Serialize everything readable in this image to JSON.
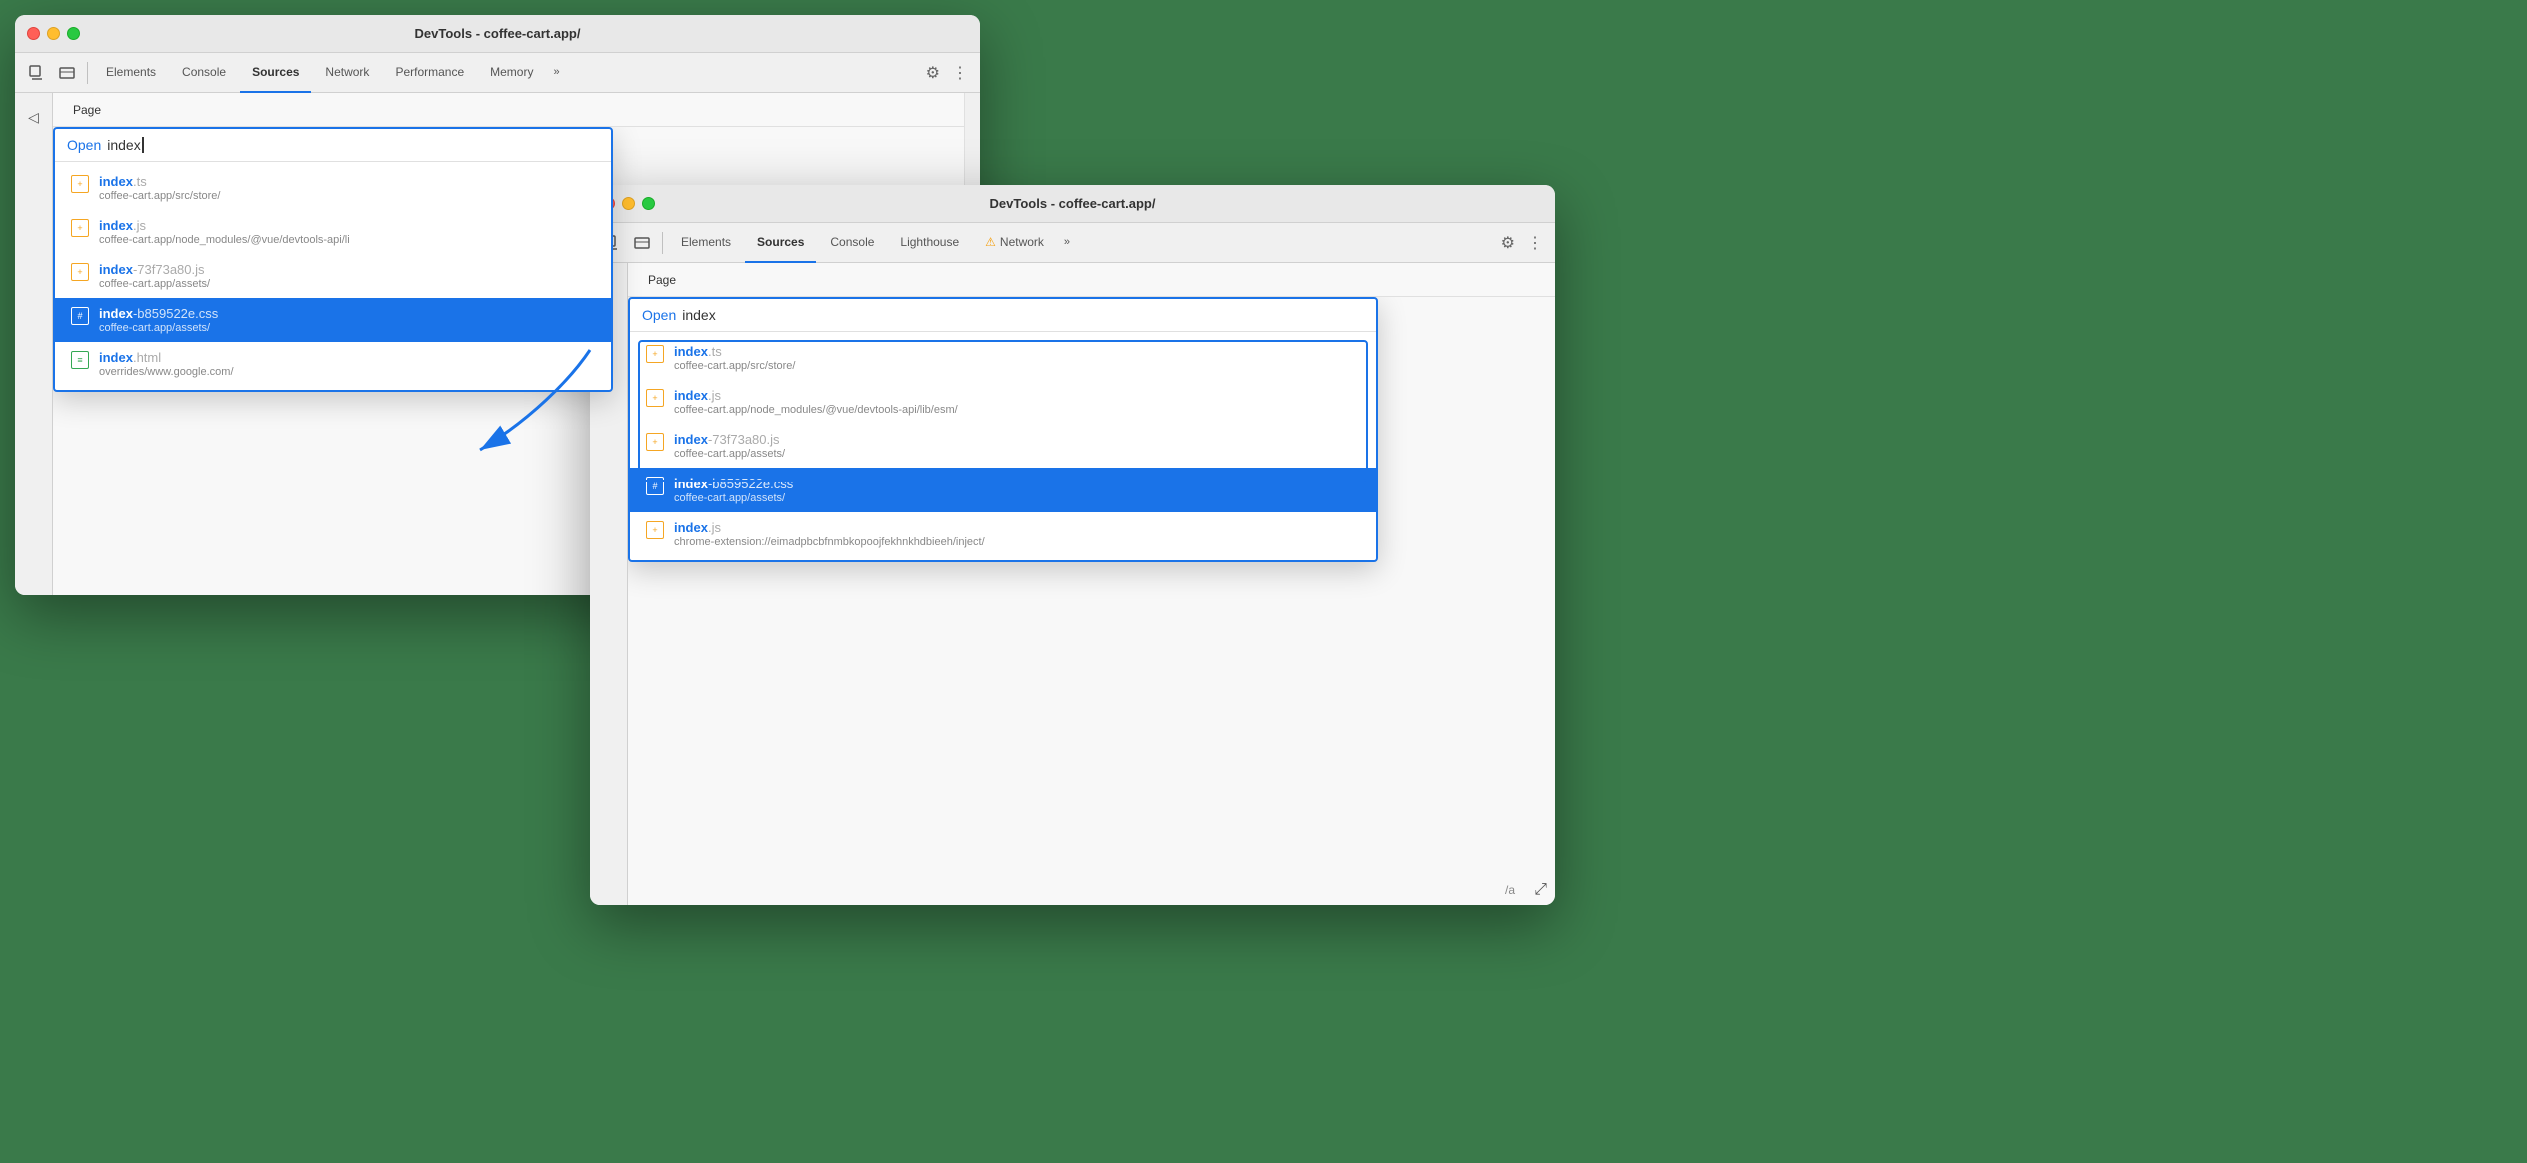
{
  "window_back": {
    "title": "DevTools - coffee-cart.app/",
    "traffic_lights": [
      "close",
      "minimize",
      "maximize"
    ],
    "tabs": [
      {
        "label": "Elements",
        "active": false
      },
      {
        "label": "Console",
        "active": false
      },
      {
        "label": "Sources",
        "active": true
      },
      {
        "label": "Network",
        "active": false
      },
      {
        "label": "Performance",
        "active": false
      },
      {
        "label": "Memory",
        "active": false
      },
      {
        "label": "»",
        "active": false
      }
    ],
    "page_tab": "Page",
    "search_prefix": "Open ",
    "search_query": "index",
    "files": [
      {
        "name_bold": "index",
        "name_dim": ".ts",
        "path": "coffee-cart.app/src/store/",
        "icon_type": "js",
        "selected": false
      },
      {
        "name_bold": "index",
        "name_dim": ".js",
        "path": "coffee-cart.app/node_modules/@vue/devtools-api/li",
        "icon_type": "js",
        "selected": false
      },
      {
        "name_bold": "index",
        "name_dim": "-73f73a80.js",
        "path": "coffee-cart.app/assets/",
        "icon_type": "js",
        "selected": false
      },
      {
        "name_bold": "index",
        "name_dim": "-b859522e.css",
        "path": "coffee-cart.app/assets/",
        "icon_type": "css",
        "selected": true
      },
      {
        "name_bold": "index",
        "name_dim": ".html",
        "path": "overrides/www.google.com/",
        "icon_type": "html",
        "selected": false
      }
    ]
  },
  "window_front": {
    "title": "DevTools - coffee-cart.app/",
    "tabs": [
      {
        "label": "Elements",
        "active": false
      },
      {
        "label": "Sources",
        "active": true
      },
      {
        "label": "Console",
        "active": false
      },
      {
        "label": "Lighthouse",
        "active": false
      },
      {
        "label": "Network",
        "active": false,
        "warning": true
      },
      {
        "label": "»",
        "active": false
      }
    ],
    "page_tab": "Page",
    "search_prefix": "Open ",
    "search_query": "index",
    "files": [
      {
        "name_bold": "index",
        "name_dim": ".ts",
        "path": "coffee-cart.app/src/store/",
        "icon_type": "js",
        "selected": false,
        "highlighted": true
      },
      {
        "name_bold": "index",
        "name_dim": ".js",
        "path": "coffee-cart.app/node_modules/@vue/devtools-api/lib/esm/",
        "icon_type": "js",
        "selected": false,
        "highlighted": true
      },
      {
        "name_bold": "index",
        "name_dim": "-73f73a80.js",
        "path": "coffee-cart.app/assets/",
        "icon_type": "js",
        "selected": false,
        "highlighted": false
      },
      {
        "name_bold": "index",
        "name_dim": "-b859522e.css",
        "path": "coffee-cart.app/assets/",
        "icon_type": "css",
        "selected": true,
        "highlighted": false
      },
      {
        "name_bold": "index",
        "name_dim": ".js",
        "path": "chrome-extension://eimadpbcbfnmbkopoojfekhnkhdbieeh/inject/",
        "icon_type": "js",
        "selected": false,
        "highlighted": false
      }
    ],
    "bottom_right_label": "/a"
  },
  "icons": {
    "cursor": "⬡",
    "layers": "◫",
    "gear": "⚙",
    "dots": "⋮",
    "collapse": "◁",
    "js_icon": "⊞",
    "css_icon": "#",
    "html_icon": "≡",
    "arrow_bracket": "‹/›"
  }
}
